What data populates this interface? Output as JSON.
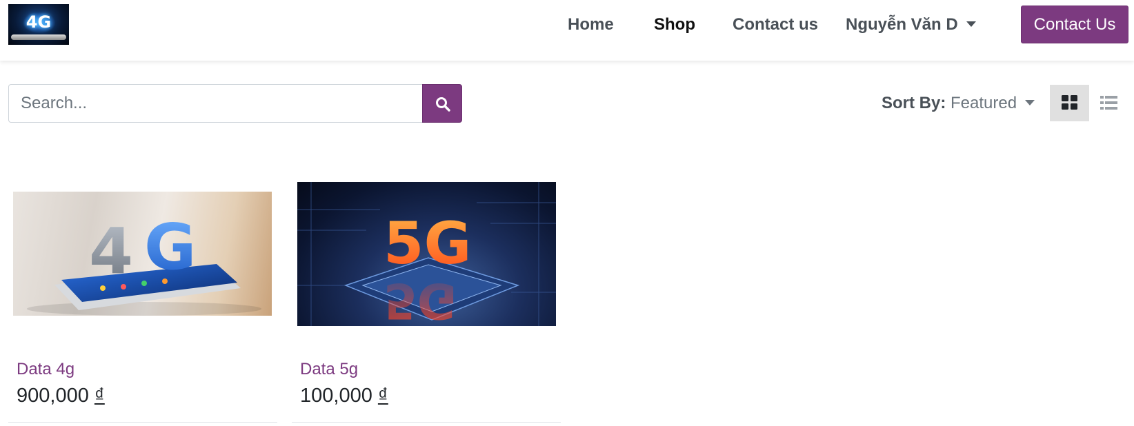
{
  "header": {
    "logo_text": "4G",
    "nav": [
      {
        "label": "Home",
        "active": false
      },
      {
        "label": "Shop",
        "active": true
      },
      {
        "label": "Contact us",
        "active": false
      }
    ],
    "user_name": "Nguyễn Văn D",
    "cta_label": "Contact Us"
  },
  "toolbar": {
    "search_placeholder": "Search...",
    "sort_label": "Sort By:",
    "sort_value": "Featured",
    "view_mode": "grid"
  },
  "products": [
    {
      "name": "Data 4g",
      "price": "900,000",
      "currency": "₫",
      "image_text": "4G"
    },
    {
      "name": "Data 5g",
      "price": "100,000",
      "currency": "₫",
      "image_text": "5G"
    }
  ],
  "colors": {
    "brand": "#7c3a80",
    "link": "#7c3a80",
    "nav_text": "#495057"
  }
}
